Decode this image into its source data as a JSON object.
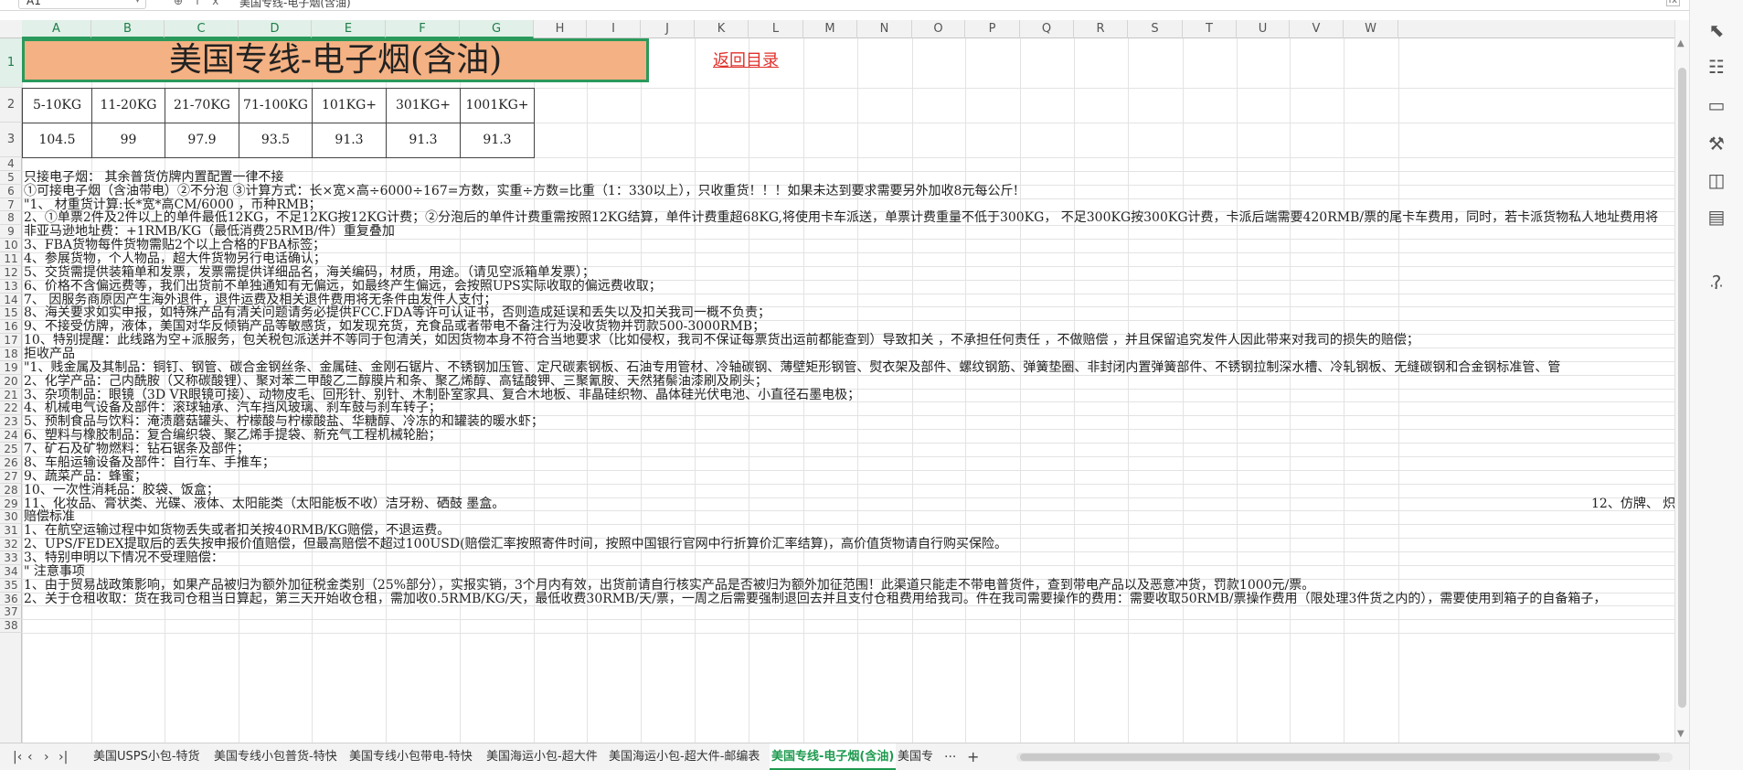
{
  "formula_bar": {
    "cell_ref": "A1",
    "fx_label": "fx",
    "content": "美国专线-电子烟(含油)",
    "expand": "fx"
  },
  "columns": [
    "A",
    "B",
    "C",
    "D",
    "E",
    "F",
    "G",
    "H",
    "I",
    "J",
    "K",
    "L",
    "M",
    "N",
    "O",
    "P",
    "Q",
    "R",
    "S",
    "T",
    "U",
    "V",
    "W"
  ],
  "rows": [
    "1",
    "2",
    "3",
    "4",
    "5",
    "6",
    "7",
    "8",
    "9",
    "10",
    "11",
    "12",
    "13",
    "14",
    "15",
    "16",
    "17",
    "18",
    "19",
    "20",
    "21",
    "22",
    "23",
    "24",
    "25",
    "26",
    "27",
    "28",
    "29",
    "30",
    "31",
    "32",
    "33",
    "34",
    "35",
    "36",
    "37",
    "38"
  ],
  "sheet": {
    "title": "美国专线-电子烟(含油)",
    "back_link": "返回目录",
    "weight_ranges": [
      "5-10KG",
      "11-20KG",
      "21-70KG",
      "71-100KG",
      "101KG+",
      "301KG+",
      "1001KG+"
    ],
    "prices": [
      "104.5",
      "99",
      "97.9",
      "93.5",
      "91.3",
      "91.3",
      "91.3"
    ],
    "lines": [
      "",
      "只接电子烟： 其余普货仿牌内置配置一律不接",
      "①可接电子烟（含油带电）②不分泡 ③计算方式：长×宽×高÷6000÷167=方数，实重÷方数=比重（1：330以上），只收重货！！！如果未达到要求需要另外加收8元每公斤!",
      "\"1、 材重货计算:长*宽*高CM/6000 ，币种RMB；",
      "2、①单票2件及2件以上的单件最低12KG，不足12KG按12KG计费；②分泡后的单件计费重需按照12KG结算，单件计费重超68KG,将使用卡车派送，单票计费重量不低于300KG， 不足300KG按300KG计费，卡派后端需要420RMB/票的尾卡车费用，同时，若卡派货物私人地址费用将",
      "非亚马逊地址费：+1RMB/KG（最低消费25RMB/件）重复叠加",
      "3、FBA货物每件货物需贴2个以上合格的FBA标签；",
      "4、参展货物，个人物品，超大件货物另行电话确认；",
      "5、交货需提供装箱单和发票，发票需提供详细品名，海关编码，材质，用途。（请见空派箱单发票）；",
      "6、价格不含偏远费等，我们出货前不单独通知有无偏远，如最终产生偏远，会按照UPS实际收取的偏远费收取；",
      "7、 因服务商原因产生海外退件，退件运费及相关退件费用将无条件由发件人支付；",
      "8、海关要求如实申报，如特殊产品有清关问题请务必提供FCC.FDA等许可认证书，否则造成延误和丢失以及扣关我司一概不负责；",
      "9、不接受仿牌，液体，美国对华反倾销产品等敏感货，如发现充货，充食品或者带电不备注行为没收货物并罚款500-3000RMB；",
      "10、特别提醒：此线路为空+派服务，包关税包派送并不等同于包清关，如因货物本身不符合当地要求（比如侵权，我司不保证每票货出运前都能查到）导致扣关 ，不承担任何责任 ，不做赔偿 ，并且保留追究发件人因此带来对我司的损失的赔偿；",
      "拒收产品",
      "\"1、贱金属及其制品：铜钉、钢管、碳合金钢丝条、金属硅、金刚石锯片、不锈钢加压管、定尺碳素钢板、石油专用管材、冷轴碳钢、薄壁矩形钢管、熨衣架及部件、螺纹钢筋、弹簧垫圈、非封闭内置弹簧部件、不锈钢拉制深水槽、冷轧钢板、无缝碳钢和合金钢标准管、管",
      "2、化学产品：己内酰胺（又称碳酸锂）、聚对苯二甲酸乙二醇膜片和条、聚乙烯醇、高锰酸钾、三聚氰胺、天然猪鬃油漆刷及刷头；",
      "3、杂项制品：眼镜（3D VR眼镜可接）、动物皮毛、回形针、别针、木制卧室家具、复合木地板、非晶硅织物、晶体硅光伏电池、小直径石墨电极；",
      "4、机械电气设备及部件：滚球轴承、汽车挡风玻璃、刹车鼓与刹车转子；",
      "5、预制食品与饮料：淹渍蘑菇罐头、柠檬酸与柠檬酸盐、华糖醇、冷冻的和罐装的暖水虾；",
      "6、塑料与橡胶制品：复合编织袋、聚乙烯手提袋、新充气工程机械轮胎；",
      "7、矿石及矿物燃料：钻石锯条及部件；",
      "8、车船运输设备及部件：自行车、手推车；",
      "9、蔬菜产品：蜂蜜；",
      "10、一次性消耗品：胶袋、饭盒；",
      "11、化妆品、膏状类、光碟、液体、太阳能类（太阳能板不收）洁牙粉、硒鼓 墨盒。",
      "赔偿标准",
      "1、在航空运输过程中如货物丢失或者扣关按40RMB/KG赔偿，不退运费。",
      "2、UPS/FEDEX提取后的丢失按申报价值赔偿，但最高赔偿不超过100USD(赔偿汇率按照寄件时间，按照中国银行官网中行折算价汇率结算)，高价值货物请自行购买保险。",
      "3、特别申明以下情况不受理赔偿：",
      "\" 注意事项",
      "1、由于贸易战政策影响，如果产品被归为额外加征税金类别（25%部分），实报实销，3个月内有效，出货前请自行核实产品是否被归为额外加征范围！此渠道只能走不带电普货件，查到带电产品以及恶意冲货，罚款1000元/票。",
      "2、关于仓租收取：货在我司仓租当日算起，第三天开始收仓租，需加收0.5RMB/KG/天，最低收费30RMB/天/票，一周之后需要强制退回去并且支付仓租费用给我司。件在我司需要操作的费用：需要收取50RMB/票操作费用（限处理3件货之内的），需要使用到箱子的自备箱子，",
      "",
      ""
    ],
    "row29_overflow": "12、仿牌、 炽"
  },
  "tabs": [
    "美国USPS小包-特货",
    "美国专线小包普货-特快",
    "美国专线小包带电-特快",
    "美国海运小包-超大件",
    "美国海运小包-超大件-邮编表",
    "美国专线-电子烟(含油)",
    "美国专"
  ],
  "tab_nav": {
    "first": "|<",
    "prev": "<",
    "next": ">",
    "last": ">|",
    "more": "···",
    "add": "+"
  },
  "toolbar_icons": [
    "cursor-icon",
    "sliders-icon",
    "comment-icon",
    "wrench-icon",
    "chart-icon",
    "book-icon",
    "help-icon",
    "more-icon"
  ]
}
